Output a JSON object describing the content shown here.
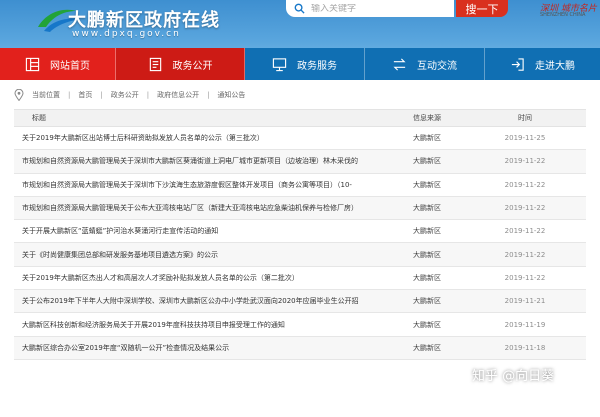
{
  "header": {
    "site_name": "大鹏新区政府在线",
    "site_url": "www.dpxq.gov.cn",
    "search": {
      "placeholder": "输入关键字",
      "button_label": "搜一下"
    },
    "brand": {
      "title": "深圳 城市名片",
      "subtitle": "SHENZHEN CHINA"
    }
  },
  "nav": {
    "items": [
      {
        "label": "网站首页",
        "icon": "home-grid-icon",
        "color": "#e2211c"
      },
      {
        "label": "政务公开",
        "icon": "document-icon",
        "color": "#cd1b15",
        "active": true
      },
      {
        "label": "政务服务",
        "icon": "monitor-icon",
        "color": "#106fb3"
      },
      {
        "label": "互动交流",
        "icon": "exchange-arrows-icon",
        "color": "#106fb3"
      },
      {
        "label": "走进大鹏",
        "icon": "enter-door-icon",
        "color": "#106fb3"
      }
    ]
  },
  "breadcrumb": {
    "prefix": "当前位置",
    "items": [
      "首页",
      "政务公开",
      "政府信息公开",
      "通知公告"
    ]
  },
  "table": {
    "headers": {
      "title": "标题",
      "source": "信息来源",
      "time": "时间"
    },
    "rows": [
      {
        "title": "关于2019年大鹏新区出站博士后科研资助拟发放人员名单的公示（第三批次）",
        "source": "大鹏新区",
        "time": "2019-11-25"
      },
      {
        "title": "市规划和自然资源局大鹏管理局关于深圳市大鹏新区葵涌街道上洞电厂城市更新项目（边坡治理）林木采伐的",
        "source": "大鹏新区",
        "time": "2019-11-22"
      },
      {
        "title": "市规划和自然资源局大鹏管理局关于深圳市下沙滨海生态旅游度假区整体开发项目（商务公寓等项目）（10-",
        "source": "大鹏新区",
        "time": "2019-11-22"
      },
      {
        "title": "市规划和自然资源局大鹏管理局关于公布大亚湾核电站厂区（新建大亚湾核电站应急柴油机保养与检修厂房）",
        "source": "大鹏新区",
        "time": "2019-11-22"
      },
      {
        "title": "关于开展大鹏新区“蓝蜻蜓”护河治水葵涌河行走宣传活动的通知",
        "source": "大鹏新区",
        "time": "2019-11-22"
      },
      {
        "title": "关于《时尚健康集团总部和研发服务基地项目遴选方案》的公示",
        "source": "大鹏新区",
        "time": "2019-11-22"
      },
      {
        "title": "关于2019年大鹏新区杰出人才和高层次人才奖励补贴拟发放人员名单的公示（第二批次）",
        "source": "大鹏新区",
        "time": "2019-11-22"
      },
      {
        "title": "关于公布2019年下半年人大附中深圳学校、深圳市大鹏新区公办中小学赴武汉面向2020年应届毕业生公开招",
        "source": "大鹏新区",
        "time": "2019-11-21"
      },
      {
        "title": "大鹏新区科技创新和经济服务局关于开展2019年度科技扶持项目申报受理工作的通知",
        "source": "大鹏新区",
        "time": "2019-11-19"
      },
      {
        "title": "大鹏新区综合办公室2019年度“双随机一公开”检查情况及结果公示",
        "source": "大鹏新区",
        "time": "2019-11-18"
      }
    ]
  },
  "watermark": "知乎 @向日葵"
}
